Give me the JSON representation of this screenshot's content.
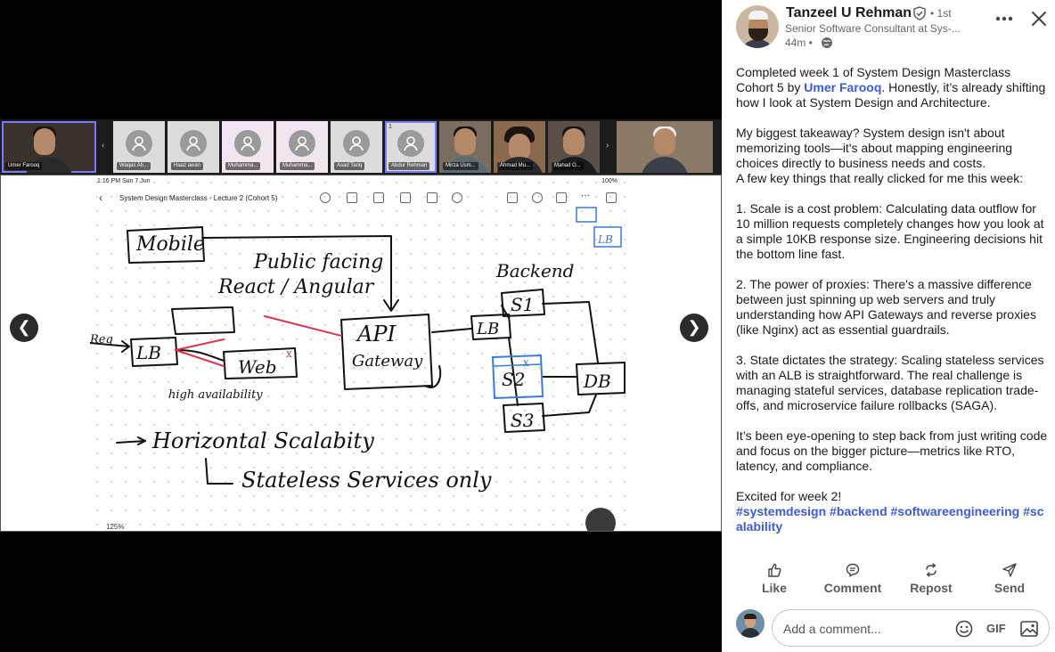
{
  "meeting": {
    "participants": [
      {
        "name": "Umer Farooq",
        "kind": "video"
      },
      {
        "name": "Waqas Ah...",
        "kind": "avatar"
      },
      {
        "name": "Haaz awan",
        "kind": "avatar"
      },
      {
        "name": "Muhamma...",
        "kind": "avatar"
      },
      {
        "name": "Muhamma...",
        "kind": "avatar"
      },
      {
        "name": "Asad Tariq",
        "kind": "avatar"
      },
      {
        "name": "Abdur Rehman",
        "kind": "avatar"
      },
      {
        "name": "Mirza Usm...",
        "kind": "video"
      },
      {
        "name": "Ahmad Mu...",
        "kind": "video"
      },
      {
        "name": "Mahad O...",
        "kind": "video"
      },
      {
        "name": "",
        "kind": "video"
      }
    ],
    "raise_hand_count": "1",
    "prev_arrow": "❮",
    "next_arrow": "❯",
    "strip_prev": "‹",
    "strip_next": "›"
  },
  "whiteboard": {
    "time": "1:16 PM  Sun 7 Jun",
    "battery": "100%",
    "title": "System Design Masterclass - Lecture 2 (Cohort 5)",
    "zoom": "125%",
    "sketch": {
      "mobile": "Mobile",
      "public_facing": "Public facing",
      "react_angular": "React / Angular",
      "backend": "Backend",
      "req": "Req",
      "lb": "LB",
      "web": "Web",
      "api": "API",
      "gateway": "Gateway",
      "s1": "S1",
      "s2": "S2",
      "s3": "S3",
      "db": "DB",
      "high_availability": "high availability",
      "horizontal": "Horizontal Scalabity",
      "stateless": "Stateless Services only",
      "x_mark": "x"
    }
  },
  "post": {
    "author": "Tanzeel U Rehman",
    "degree": "• 1st",
    "headline": "Senior Software Consultant at Sys-...",
    "time": "44m •",
    "body": {
      "p1_a": "Completed week 1 of System Design Masterclass Cohort 5 by ",
      "p1_mention": "Umer Farooq",
      "p1_b": ". Honestly, it’s already shifting how I look at System Design and Architecture.",
      "p2_a": "My biggest takeaway? System design isn't about memorizing tools—it's about mapping engineering choices directly to business needs and costs.",
      "p2_b": "A few key things that really clicked for me this week:",
      "p3": "1. Scale is a cost problem: Calculating data outflow for 10 million requests completely changes how you look at a simple 10KB response size. Engineering decisions hit the bottom line fast.",
      "p4": "2. The power of proxies: There's a massive difference between just spinning up web servers and truly understanding how API Gateways and reverse proxies (like Nginx) act as essential guardrails.",
      "p5": "3. State dictates the strategy: Scaling stateless services with an ALB is straightforward. The real challenge is managing stateful services, database replication trade-offs, and microservice failure rollbacks (SAGA).",
      "p6": "It’s been eye-opening to step back from just writing code and focus on the bigger picture—metrics like RTO, latency, and compliance.",
      "p7": "Excited for week 2!",
      "hashtags": "#systemdesign #backend #softwareengineering #scalability"
    },
    "actions": {
      "like": "Like",
      "comment": "Comment",
      "repost": "Repost",
      "send": "Send"
    },
    "comment": {
      "placeholder": "Add a comment...",
      "gif": "GIF"
    }
  },
  "colors": {
    "link": "#3b5bdb",
    "speaking_outline": "#7b79ff",
    "sketch_blue": "#3a7bd5",
    "sketch_red": "#d9364f"
  }
}
